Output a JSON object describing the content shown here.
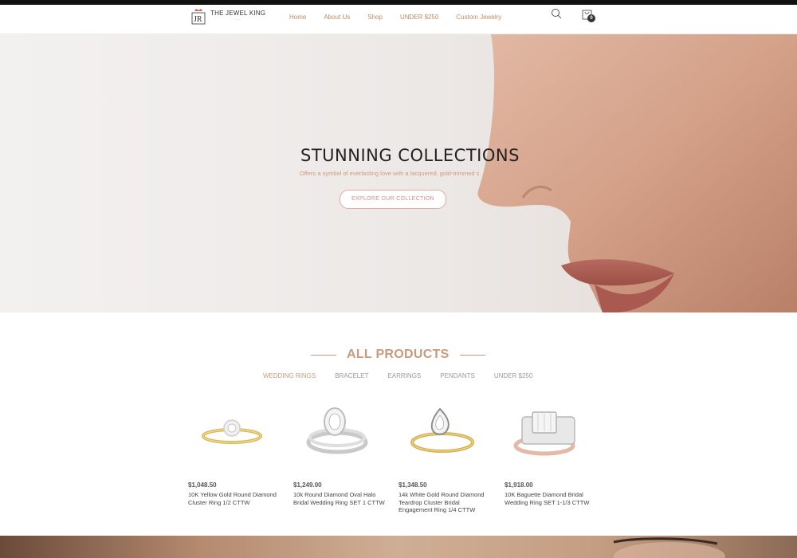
{
  "brand": {
    "name": "THE JEWEL KING"
  },
  "nav": {
    "items": [
      "Home",
      "About Us",
      "Shop",
      "UNDER $250",
      "Custom Jewelry"
    ]
  },
  "cart": {
    "count": "0"
  },
  "hero": {
    "title": "STUNNING COLLECTIONS",
    "subtitle": "Offers a symbol of everlasting love with a lacquered, gold-trimmed s",
    "button": "EXPLORE OUR COLLECTION"
  },
  "products_section": {
    "title": "ALL PRODUCTS",
    "tabs": [
      "WEDDING RINGS",
      "BRACELET",
      "EARRINGS",
      "PENDANTS",
      "UNDER $250"
    ],
    "active_tab": "WEDDING RINGS"
  },
  "products": [
    {
      "price": "$1,048.50",
      "name": "10K Yellow Gold Round Diamond Cluster Ring 1/2 CTTW"
    },
    {
      "price": "$1,249.00",
      "name": "10k Round Diamond Oval Halo Bridal Wedding Ring SET 1 CTTW"
    },
    {
      "price": "$1,348.50",
      "name": "14k White Gold Round Diamond Teardrop Cluster Bridal Engagement Ring 1/4 CTTW"
    },
    {
      "price": "$1,918.00",
      "name": "10K Baguette Diamond Bridal Wedding Ring SET 1-1/3 CTTW"
    }
  ],
  "colors": {
    "accent": "#c99a7c",
    "nav_link": "#c08a64",
    "button_border": "#e4a9a0"
  }
}
